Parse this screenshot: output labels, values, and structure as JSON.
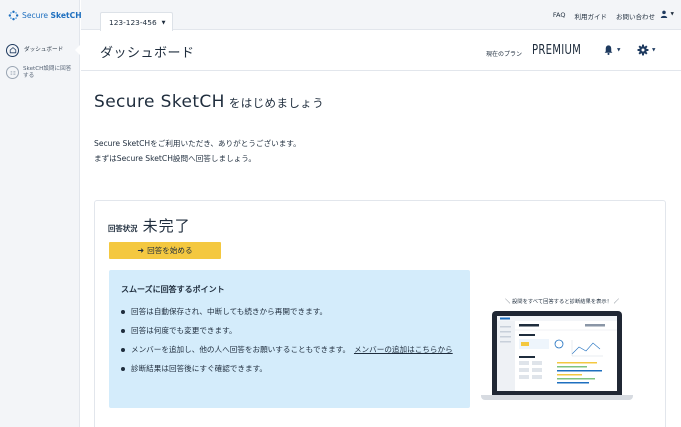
{
  "app": {
    "logo_prefix": "Secure ",
    "logo_bold": "SketCH",
    "brand_color": "#1e6fbf"
  },
  "sidebar": {
    "items": [
      {
        "label": "ダッシュボード",
        "icon": "house-icon",
        "active": true
      },
      {
        "label": "SketCH設問に回答する",
        "icon": "checklist-icon",
        "active": false
      }
    ]
  },
  "topbar": {
    "account_id": "123-123-456",
    "links": [
      "FAQ",
      "利用ガイド",
      "お問い合わせ"
    ],
    "user_icon": "user-icon"
  },
  "header": {
    "title": "ダッシュボード",
    "plan_label": "現在のプラン",
    "plan_value": "PREMIUM",
    "bell_icon": "bell-icon",
    "gear_icon": "gear-icon"
  },
  "main": {
    "hero_title": "Secure SketCH",
    "hero_suffix": "をはじめましょう",
    "intro_line1": "Secure SketCHをご利用いただき、ありがとうございます。",
    "intro_line2": "まずはSecure SketCH設問へ回答しましょう。"
  },
  "status": {
    "label": "回答状況",
    "value": "未完了",
    "button_label": "回答を始める",
    "button_color": "#f4c840"
  },
  "tips": {
    "title": "スムーズに回答するポイント",
    "items": [
      "回答は自動保存され、中断しても続きから再開できます。",
      "回答は何度でも変更できます。",
      "メンバーを追加し、他の人へ回答をお願いすることもできます。",
      "診断結果は回答後にすぐ確認できます。"
    ],
    "link_label": "メンバーの追加はこちらから",
    "background": "#d4ecfb"
  },
  "preview": {
    "caption": "設問をすべて回答すると診断結果を表示！"
  }
}
